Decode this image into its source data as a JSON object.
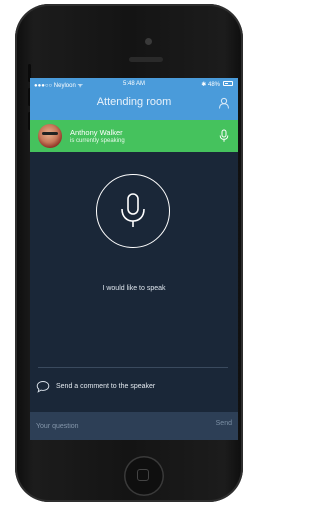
{
  "status_bar": {
    "carrier": "●●●○○ Neyloon ᯤ",
    "time": "5:48 AM",
    "battery": "✱ 48%"
  },
  "header": {
    "title": "Attending room",
    "icon": "user-icon"
  },
  "current_speaker": {
    "name": "Anthony Walker",
    "status": "is currently speaking",
    "icon": "microphone-icon"
  },
  "speak_request": {
    "icon": "microphone-icon",
    "label": "I would like to speak"
  },
  "comment": {
    "icon": "chat-bubble-icon",
    "label": "Send a comment to the speaker"
  },
  "question_input": {
    "placeholder": "Your question",
    "value": ""
  },
  "send_button": {
    "label": "Send"
  },
  "colors": {
    "header": "#4a9bda",
    "speaker_bar": "#45c25d",
    "background": "#1a2738",
    "input_bar": "#2d3f56"
  }
}
